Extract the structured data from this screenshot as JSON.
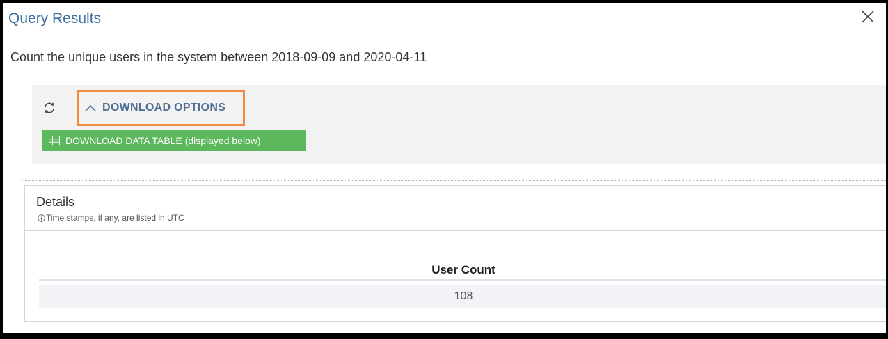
{
  "modal": {
    "title": "Query Results"
  },
  "query": {
    "description": "Count the unique users in the system between 2018-09-09 and 2020-04-11"
  },
  "download_options": {
    "toggle_label": "DOWNLOAD OPTIONS",
    "download_table_label": "DOWNLOAD DATA TABLE  (displayed below)"
  },
  "details": {
    "title": "Details",
    "note": "Time stamps, if any, are listed in UTC"
  },
  "table": {
    "columns": [
      "User Count"
    ],
    "rows": [
      [
        "108"
      ]
    ]
  },
  "icons": {
    "close": "close-icon",
    "refresh": "refresh-icon",
    "chevron": "chevron-up-icon",
    "grid": "table-grid-icon",
    "info": "info-icon"
  },
  "colors": {
    "title_blue": "#3c6e9e",
    "highlight_orange": "#f08a3c",
    "button_green": "#5cb85c",
    "label_blue": "#4f6f94"
  }
}
